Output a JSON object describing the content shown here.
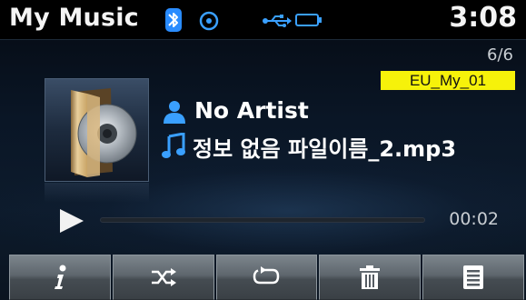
{
  "status_bar": {
    "title": "My Music",
    "clock": "3:08",
    "icons": [
      "bluetooth-icon",
      "disc-icon",
      "usb-icon",
      "battery-icon"
    ]
  },
  "info": {
    "track_count": "6/6",
    "playlist_badge": "EU_My_01",
    "artist": "No Artist",
    "file_name": "정보 없음 파일이름_2.mp3"
  },
  "playback": {
    "elapsed": "00:02",
    "progress": 0.0
  },
  "controls": [
    {
      "name": "info-button",
      "icon": "info-icon"
    },
    {
      "name": "shuffle-button",
      "icon": "shuffle-icon"
    },
    {
      "name": "repeat-button",
      "icon": "repeat-icon"
    },
    {
      "name": "delete-button",
      "icon": "trash-icon"
    },
    {
      "name": "list-button",
      "icon": "list-icon"
    }
  ],
  "colors": {
    "badge": "#f6f20a",
    "accent_blue": "#3aa0ff",
    "background": "#0a1626"
  }
}
